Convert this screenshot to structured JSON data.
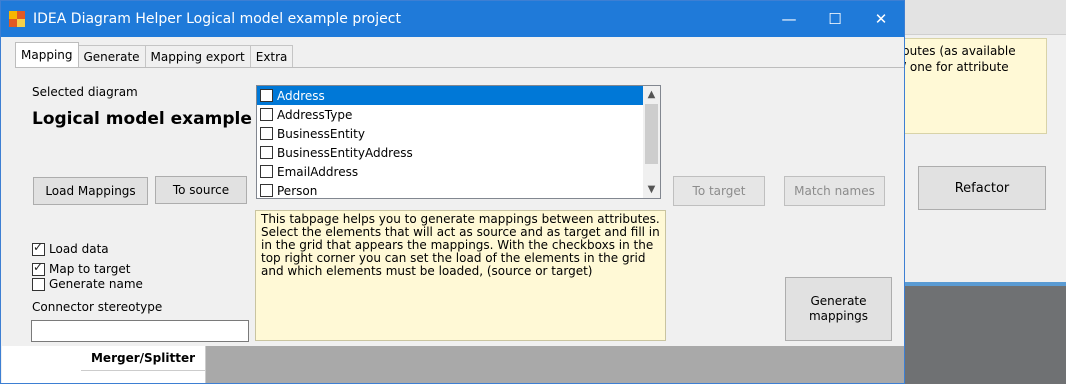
{
  "window": {
    "title": "IDEA Diagram Helper Logical model example project",
    "minimize_glyph": "—",
    "maximize_glyph": "☐",
    "close_glyph": "✕"
  },
  "tabs": [
    {
      "label": "Mapping",
      "active": true
    },
    {
      "label": "Generate",
      "active": false
    },
    {
      "label": "Mapping export",
      "active": false
    },
    {
      "label": "Extra",
      "active": false
    }
  ],
  "mapping": {
    "selected_diagram_label": "Selected diagram",
    "diagram_name": "Logical model example p",
    "load_mappings_button": "Load Mappings",
    "to_source_button": "To source",
    "to_target_button": "To target",
    "match_names_button": "Match names",
    "generate_mappings_button": [
      "Generate",
      "mappings"
    ],
    "elements": [
      {
        "label": "Address",
        "checked": false,
        "selected": true
      },
      {
        "label": "AddressType",
        "checked": false,
        "selected": false
      },
      {
        "label": "BusinessEntity",
        "checked": false,
        "selected": false
      },
      {
        "label": "BusinessEntityAddress",
        "checked": false,
        "selected": false
      },
      {
        "label": "EmailAddress",
        "checked": false,
        "selected": false
      },
      {
        "label": "Person",
        "checked": false,
        "selected": false
      }
    ],
    "info_text": "This tabpage helps you to generate mappings between attributes. Select the elements that will act as source and as target and fill in in the grid that appears the mappings.  With the checkboxs in the top right corner you can set the load of the elements in the grid and which elements must be loaded, (source or target)",
    "options": [
      {
        "label": "Load data",
        "checked": true
      },
      {
        "label": "Map to target",
        "checked": true
      },
      {
        "label": "Generate name",
        "checked": false
      }
    ],
    "connector_stereotype_label": "Connector stereotype",
    "connector_stereotype_value": "",
    "grid_column": "Merger/Splitter"
  },
  "background": {
    "note_text": "butes (as available\n/ one for attribute",
    "refactor_button": "Refactor"
  },
  "colors": {
    "titlebar": "#1f7ad9",
    "selection": "#0078d7",
    "info_background": "#fff9d6"
  }
}
